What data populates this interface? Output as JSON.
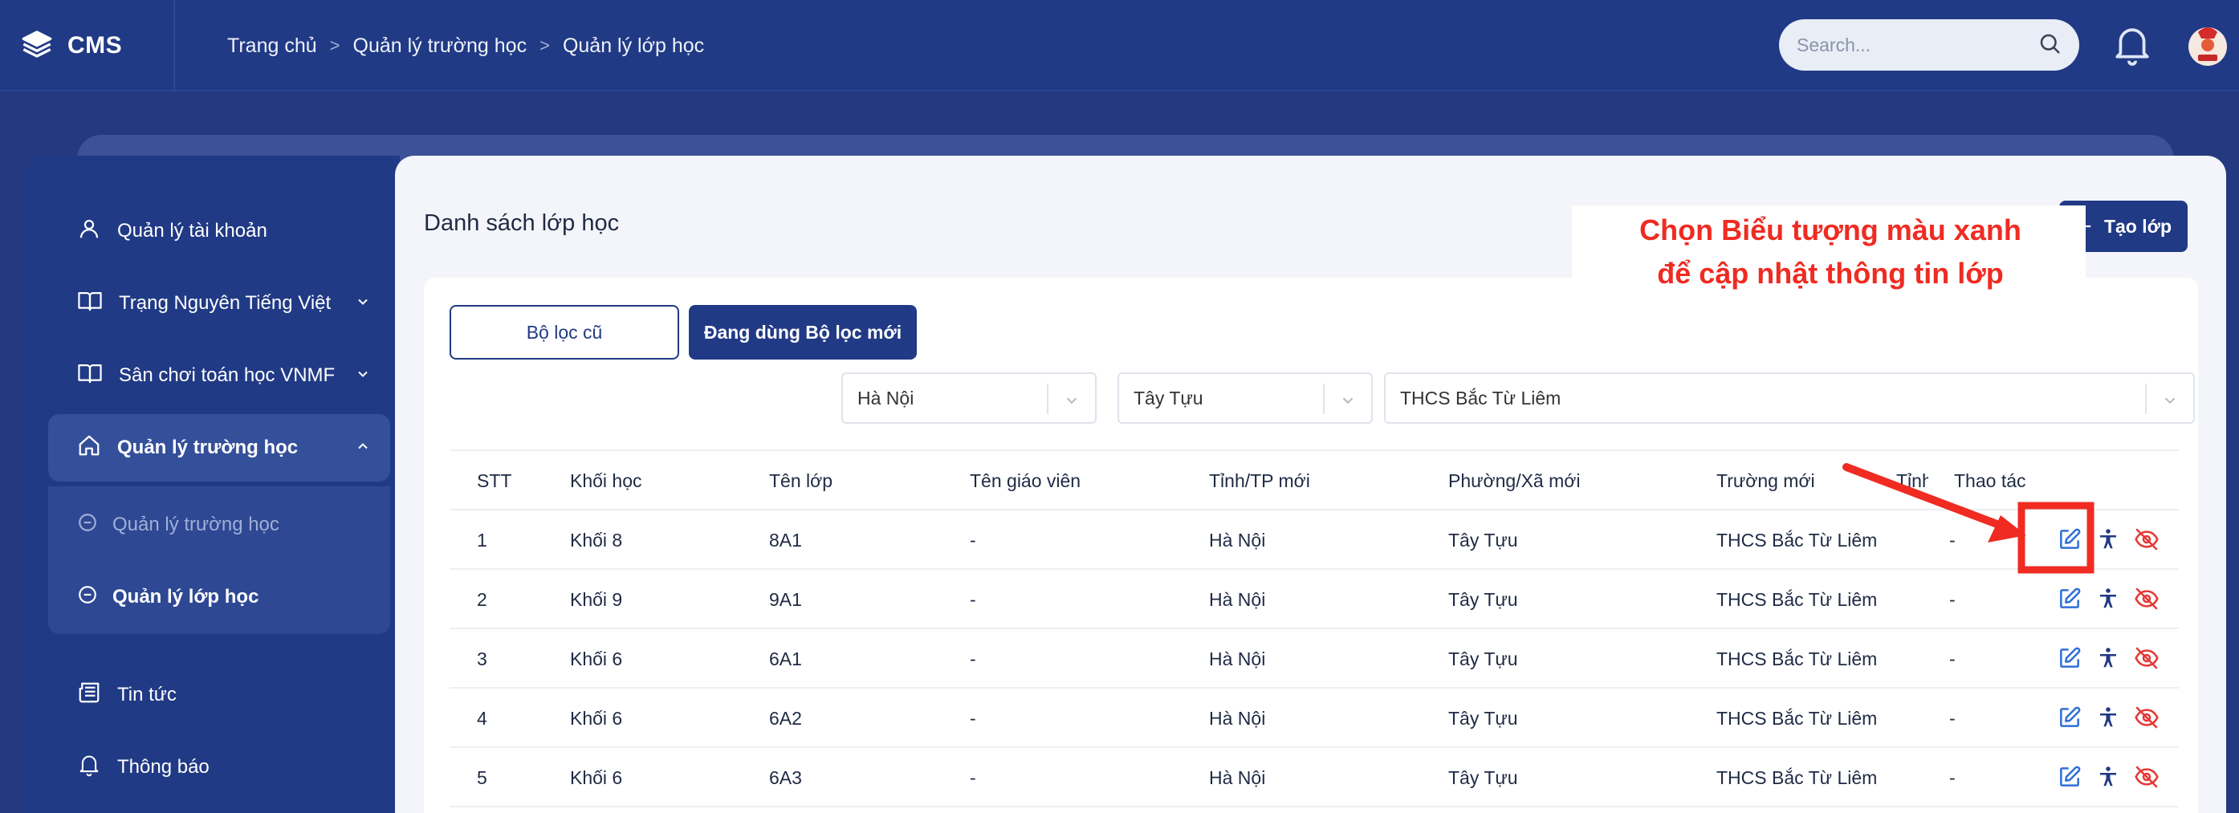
{
  "brand": {
    "name": "CMS"
  },
  "breadcrumb": [
    "Trang chủ",
    "Quản lý trường học",
    "Quản lý lớp học"
  ],
  "search": {
    "placeholder": "Search..."
  },
  "sidebar": {
    "items": [
      {
        "label": "Quản lý tài khoản",
        "icon": "user-icon"
      },
      {
        "label": "Trạng Nguyên Tiếng Việt",
        "icon": "book-icon"
      },
      {
        "label": "Sân chơi toán học VNMF",
        "icon": "book-icon"
      },
      {
        "label": "Quản lý trường học",
        "icon": "home-icon"
      },
      {
        "label": "Tin tức",
        "icon": "newspaper-icon"
      },
      {
        "label": "Thông báo",
        "icon": "bell-icon"
      }
    ],
    "subitems": [
      {
        "label": "Quản lý trường học",
        "active": false
      },
      {
        "label": "Quản lý lớp học",
        "active": true
      }
    ]
  },
  "page": {
    "title": "Danh sách lớp học",
    "create_label": "Tạo lớp",
    "filter_old_label": "Bộ lọc cũ",
    "filter_new_label": "Đang dùng Bộ lọc mới",
    "filters": {
      "province": "Hà Nội",
      "ward": "Tây Tựu",
      "school": "THCS Bắc Từ Liêm"
    }
  },
  "table": {
    "headers": [
      "STT",
      "Khối học",
      "Tên lớp",
      "Tên giáo viên",
      "Tỉnh/TP mới",
      "Phường/Xã mới",
      "Trường mới",
      "Tỉnh",
      "Thao tác"
    ],
    "rows": [
      [
        "1",
        "Khối 8",
        "8A1",
        "-",
        "Hà Nội",
        "Tây Tựu",
        "THCS Bắc Từ Liêm",
        "-"
      ],
      [
        "2",
        "Khối 9",
        "9A1",
        "-",
        "Hà Nội",
        "Tây Tựu",
        "THCS Bắc Từ Liêm",
        "-"
      ],
      [
        "3",
        "Khối 6",
        "6A1",
        "-",
        "Hà Nội",
        "Tây Tựu",
        "THCS Bắc Từ Liêm",
        "-"
      ],
      [
        "4",
        "Khối 6",
        "6A2",
        "-",
        "Hà Nội",
        "Tây Tựu",
        "THCS Bắc Từ Liêm",
        "-"
      ],
      [
        "5",
        "Khối 6",
        "6A3",
        "-",
        "Hà Nội",
        "Tây Tựu",
        "THCS Bắc Từ Liêm",
        "-"
      ]
    ]
  },
  "annotation": {
    "line1": "Chọn Biểu tượng màu xanh",
    "line2": "để cập nhật thông tin lớp"
  },
  "colors": {
    "navy": "#213a85",
    "accent_blue": "#2f6fd6",
    "danger_red": "#e53935",
    "annotation_red": "#ef2b22"
  }
}
